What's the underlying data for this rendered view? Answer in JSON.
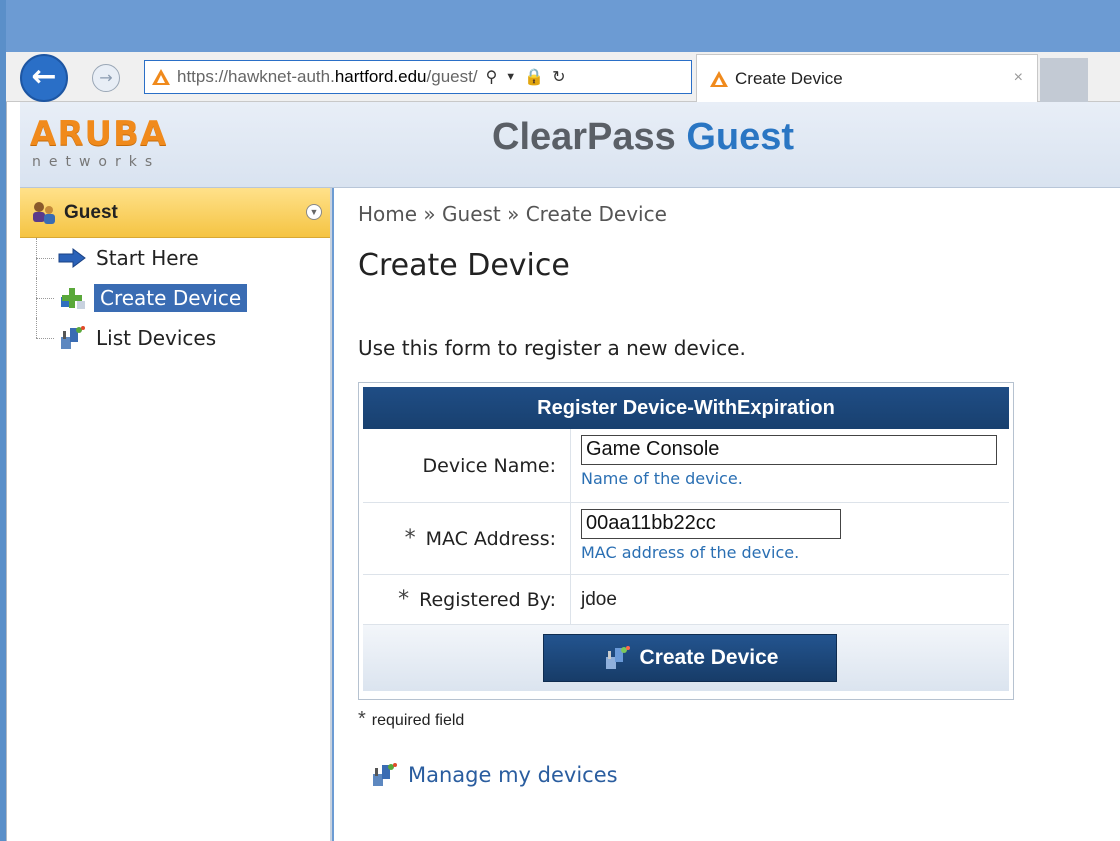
{
  "browser": {
    "url_prefix": "https://",
    "url_host_pre": "hawknet-auth.",
    "url_host_main": "hartford.edu",
    "url_path": "/guest/",
    "tab_title": "Create Device",
    "tab_close": "×"
  },
  "header": {
    "logo_top": "ARUBA",
    "logo_bottom": "networks",
    "title_part1": "ClearPass",
    "title_part2": "Guest"
  },
  "sidebar": {
    "heading": "Guest",
    "items": [
      {
        "label": "Start Here"
      },
      {
        "label": "Create Device"
      },
      {
        "label": "List Devices"
      }
    ]
  },
  "main": {
    "breadcrumb": "Home » Guest » Create Device",
    "title": "Create Device",
    "intro": "Use this form to register a new device.",
    "form": {
      "heading": "Register Device-WithExpiration",
      "device_name_label": "Device Name:",
      "device_name_value": "Game Console",
      "device_name_hint": "Name of the device.",
      "mac_label": "MAC Address:",
      "mac_value": "00aa11bb22cc",
      "mac_hint": "MAC address of the device.",
      "registered_by_label": "Registered By:",
      "registered_by_value": "jdoe",
      "required_marker": "*",
      "submit_label": "Create Device"
    },
    "required_note": "required field",
    "manage_link": "Manage my devices"
  },
  "colors": {
    "accent": "#2a76c3",
    "header_bar": "#1f4d85",
    "sidebar_head": "#f5c443",
    "selected": "#3a6cb3",
    "brand_orange": "#f08a1c"
  }
}
